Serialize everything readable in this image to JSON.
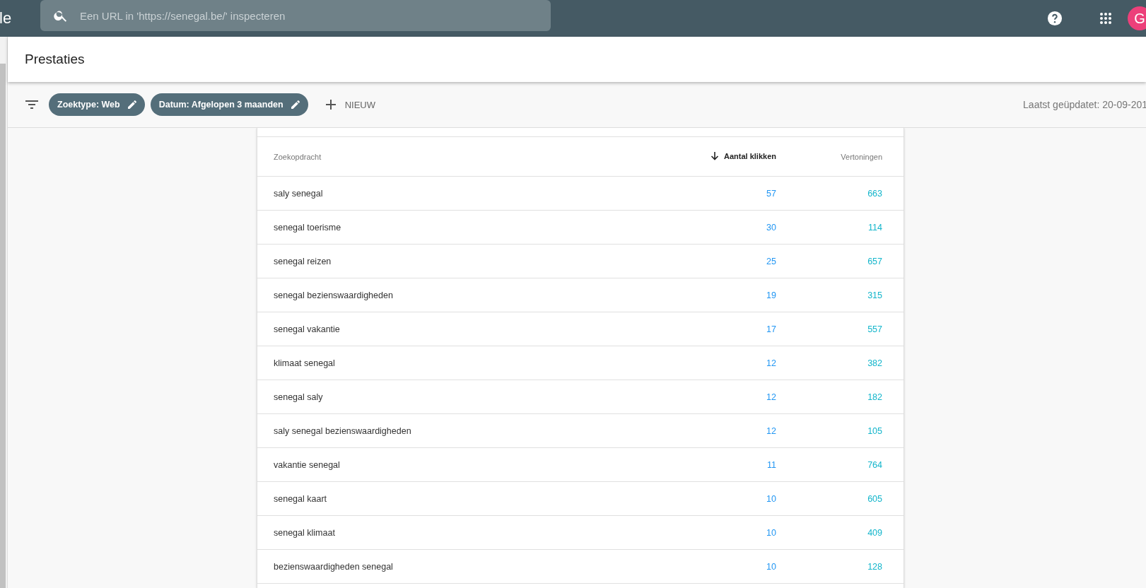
{
  "topbar": {
    "logo_text": "le",
    "search": {
      "placeholder": "Een URL in 'https://senegal.be/' inspecteren"
    },
    "avatar_letter": "G"
  },
  "page_title": "Prestaties",
  "filters": {
    "chips": [
      {
        "label": "Zoektype: Web"
      },
      {
        "label": "Datum: Afgelopen 3 maanden"
      }
    ],
    "new_label": "NIEUW",
    "last_updated": "Laatst geüpdatet: 20-09-201"
  },
  "table": {
    "columns": [
      {
        "label": "Zoekopdracht",
        "sorted": false,
        "kind": "text"
      },
      {
        "label": "Aantal klikken",
        "sorted": true,
        "kind": "clicks"
      },
      {
        "label": "Vertoningen",
        "sorted": false,
        "kind": "impressions"
      }
    ],
    "rows": [
      [
        "saly senegal",
        "57",
        "663"
      ],
      [
        "senegal toerisme",
        "30",
        "114"
      ],
      [
        "senegal reizen",
        "25",
        "657"
      ],
      [
        "senegal bezienswaardigheden",
        "19",
        "315"
      ],
      [
        "senegal vakantie",
        "17",
        "557"
      ],
      [
        "klimaat senegal",
        "12",
        "382"
      ],
      [
        "senegal saly",
        "12",
        "182"
      ],
      [
        "saly senegal bezienswaardigheden",
        "12",
        "105"
      ],
      [
        "vakantie senegal",
        "11",
        "764"
      ],
      [
        "senegal kaart",
        "10",
        "605"
      ],
      [
        "senegal klimaat",
        "10",
        "409"
      ],
      [
        "bezienswaardigheden senegal",
        "10",
        "128"
      ]
    ]
  }
}
